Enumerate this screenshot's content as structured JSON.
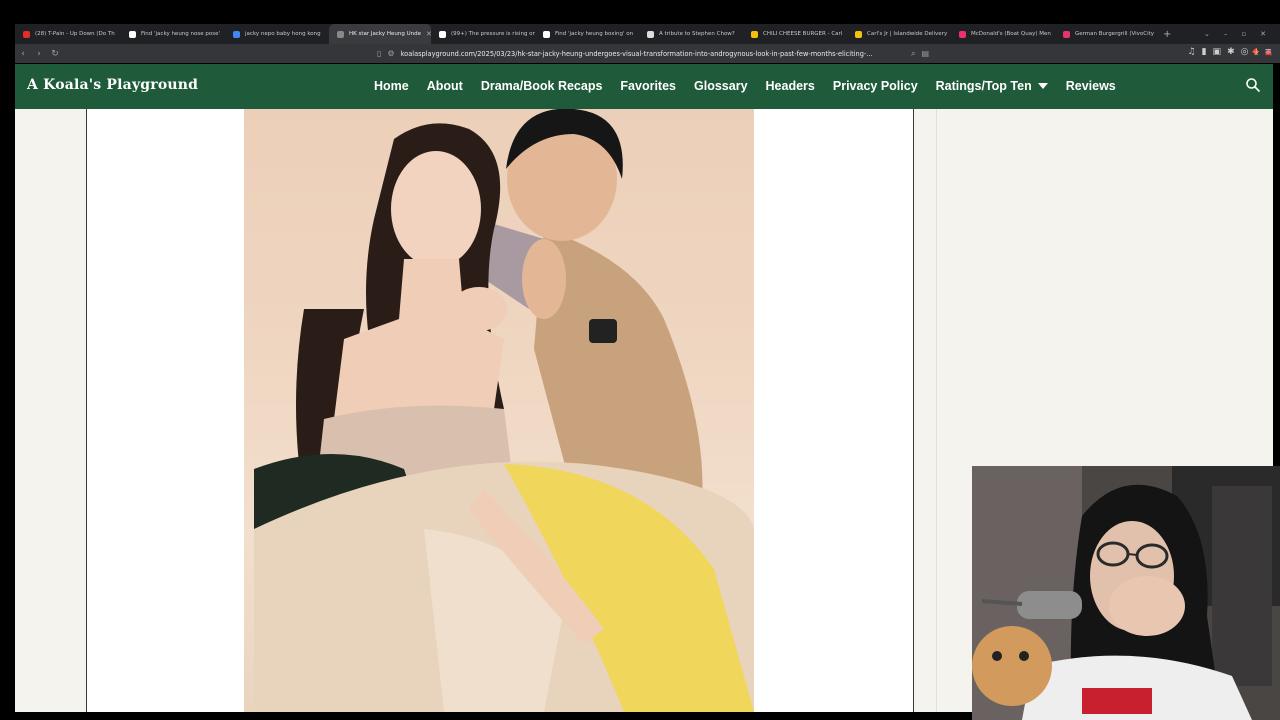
{
  "browser": {
    "tabs": [
      {
        "title": "(28) T-Pain - Up Down (Do Th",
        "color": "#e52d27"
      },
      {
        "title": "Find 'jacky heung nose pose'",
        "color": "#ffffff"
      },
      {
        "title": "jacky nepo baby hong kong",
        "color": "#4285f4"
      },
      {
        "title": "HK star Jacky Heung Unde",
        "color": "#888888",
        "active": true
      },
      {
        "title": "(99+) The pressure is rising on",
        "color": "#ffffff"
      },
      {
        "title": "Find 'jacky heung boxing' on",
        "color": "#ffffff"
      },
      {
        "title": "A tribute to Stephen Chow?",
        "color": "#dddddd"
      },
      {
        "title": "CHILI CHEESE BURGER - Carl",
        "color": "#f4c20d"
      },
      {
        "title": "Carl's Jr | Islandwide Delivery",
        "color": "#f4c20d"
      },
      {
        "title": "McDonald's (Boat Quay) Men",
        "color": "#e8336d"
      },
      {
        "title": "German Burgergrill (VivoCity",
        "color": "#e8336d"
      }
    ],
    "url": "koalasplayground.com/2025/03/23/hk-star-jacky-heung-undergoes-visual-transformation-into-androgynous-look-in-past-few-months-eliciting-..."
  },
  "site": {
    "title": "A Koala's Playground",
    "menu": [
      "Home",
      "About",
      "Drama/Book Recaps",
      "Favorites",
      "Glossary",
      "Headers",
      "Privacy Policy",
      "Ratings/Top Ten",
      "Reviews"
    ],
    "accent": "#1f5b3a"
  },
  "icons": {
    "search": "search-icon",
    "dropdown": "caret-down-icon"
  }
}
